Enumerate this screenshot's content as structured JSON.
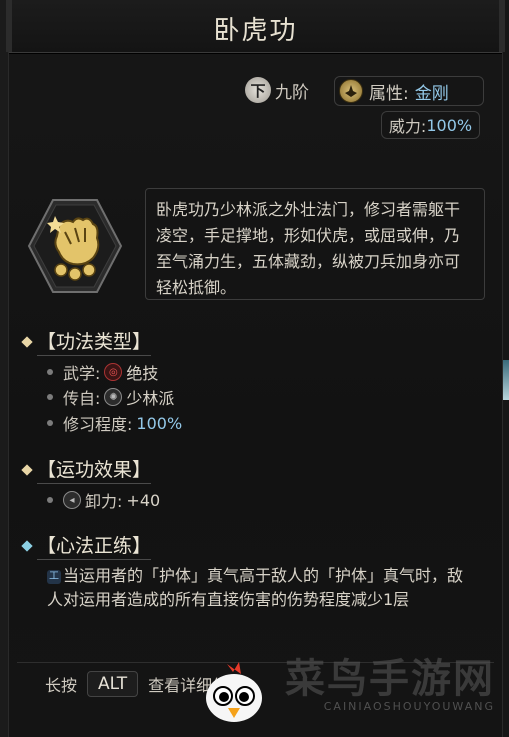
{
  "title": "卧虎功",
  "grade": {
    "icon_char": "下",
    "text": "九阶"
  },
  "attribute": {
    "label": "属性:",
    "value": "金刚"
  },
  "power": {
    "label": "威力:",
    "value": "100%"
  },
  "skill_icon": "tiger-palm-icon",
  "description": "卧虎功乃少林派之外壮法门，修习者需躯干凌空，手足撑地，形如伏虎，或屈或伸，乃至气涌力生，五体藏劲，纵被刀兵加身亦可轻松抵御。",
  "sections": {
    "technique_type": {
      "heading": "【功法类型】",
      "rows": [
        {
          "label": "武学:",
          "value": "绝技"
        },
        {
          "label": "传自:",
          "value": "少林派"
        },
        {
          "label": "修习程度:",
          "value": "100%"
        }
      ]
    },
    "effect": {
      "heading": "【运功效果】",
      "rows": [
        {
          "label": "卸力:",
          "value": "+40"
        }
      ]
    },
    "mind": {
      "heading": "【心法正练】",
      "text": "当运用者的「护体」真气高于敌人的「护体」真气时，敌人对运用者造成的所有直接伤害的伤势程度减少1层"
    }
  },
  "footer": {
    "prefix": "长按",
    "key": "ALT",
    "suffix": "查看详细信息…"
  },
  "watermark": {
    "title": "菜鸟手游网",
    "subtitle": "CAINIAOSHOUYOUWANG"
  }
}
